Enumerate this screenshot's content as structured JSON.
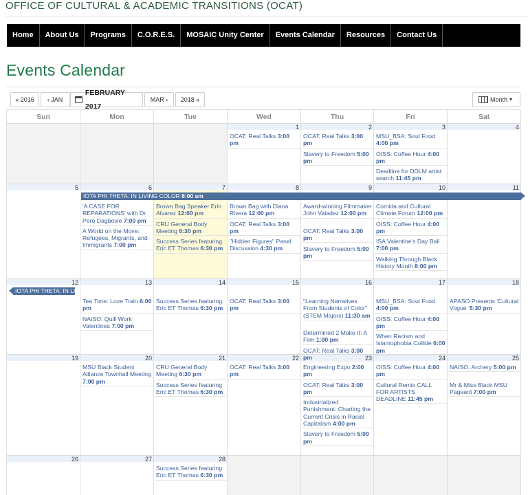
{
  "site": {
    "title": "OFFICE OF CULTURAL & ACADEMIC TRANSITIONS (OCAT)"
  },
  "nav": [
    "Home",
    "About Us",
    "Programs",
    "C.O.R.E.S.",
    "MOSAIC Unity Center",
    "Events Calendar",
    "Resources",
    "Contact Us"
  ],
  "page_title": "Events Calendar",
  "toolbar": {
    "prev_year": "« 2016",
    "prev_month": "‹ JAN",
    "current": "FEBRUARY 2017",
    "next_month": "MAR ›",
    "next_year": "2018 »",
    "view": "Month",
    "calendar_icon": "calendar-icon",
    "view_icon": "grid-icon"
  },
  "weekdays": [
    "Sun",
    "Mon",
    "Tue",
    "Wed",
    "Thu",
    "Fri",
    "Sat"
  ],
  "colors": {
    "brand_green": "#1e7a4a",
    "nav_bg": "#000000",
    "event_link": "#3a5f9a",
    "multi_day_bar": "#4d6f9c",
    "today_bg": "#fffbd8",
    "outside_month_bg": "#f2f2f2"
  },
  "weeks": [
    [
      {
        "day": "",
        "out": true,
        "events": []
      },
      {
        "day": "",
        "out": true,
        "events": []
      },
      {
        "day": "",
        "out": true,
        "events": []
      },
      {
        "day": "1",
        "events": [
          {
            "title": "OCAT: Real Talks",
            "time": "3:00 pm"
          }
        ]
      },
      {
        "day": "2",
        "events": [
          {
            "title": "OCAT: Real Talks",
            "time": "3:00 pm"
          },
          {
            "title": "Slavery to Freedom",
            "time": "5:00 pm"
          }
        ]
      },
      {
        "day": "3",
        "events": [
          {
            "title": "MSU_BSA: Soul Food",
            "time": "4:00 pm"
          },
          {
            "title": "OISS: Coffee Hour",
            "time": "4:00 pm"
          },
          {
            "title": "Deadline for DDLM artist search",
            "time": "11:45 pm"
          }
        ]
      },
      {
        "day": "4",
        "events": []
      }
    ],
    [
      {
        "day": "5",
        "events": []
      },
      {
        "day": "6",
        "events": [
          {
            "title": "'A CASE FOR REPARATIONS' with Dr. Pero Dagbovie",
            "time": "7:00 pm"
          },
          {
            "title": "A World on the Move: Refugees, Migrants, and Immigrants",
            "time": "7:00 pm"
          }
        ]
      },
      {
        "day": "7",
        "today": true,
        "events": [
          {
            "title": "Brown Bag Speaker Erin Alvarez",
            "time": "12:00 pm"
          },
          {
            "title": "CRU General Body Meeting",
            "time": "6:30 pm"
          },
          {
            "title": "Success Series featuring Eric ET Thomas",
            "time": "6:30 pm"
          }
        ]
      },
      {
        "day": "8",
        "events": [
          {
            "title": "Brown Bag with Diana Rivera",
            "time": "12:00 pm"
          },
          {
            "title": "OCAT: Real Talks",
            "time": "3:00 pm"
          },
          {
            "title": "\"Hidden Figures\" Panel Discussion",
            "time": "4:30 pm"
          }
        ]
      },
      {
        "day": "9",
        "events": [
          {
            "title": "Award-winning Filmmaker John Valadez",
            "time": "12:00 pm"
          },
          {
            "title": "OCAT: Real Talks",
            "time": "3:00 pm"
          },
          {
            "title": "Slavery to Freedom",
            "time": "5:00 pm"
          }
        ]
      },
      {
        "day": "10",
        "events": [
          {
            "title": "Comida and Cultural Climate Forum",
            "time": "12:00 pm"
          },
          {
            "title": "OISS: Coffee Hour",
            "time": "4:00 pm"
          },
          {
            "title": "ISA Valentine's Day Ball",
            "time": "7:00 pm"
          },
          {
            "title": "Walking Through Black History Month",
            "time": "8:00 pm"
          }
        ]
      },
      {
        "day": "11",
        "events": []
      }
    ],
    [
      {
        "day": "12",
        "events": []
      },
      {
        "day": "13",
        "events": [
          {
            "title": "Tea Time: Love Train",
            "time": "6:00 pm"
          },
          {
            "title": "NAISO: Quill Work Valentines",
            "time": "7:00 pm"
          }
        ]
      },
      {
        "day": "14",
        "events": [
          {
            "title": "Success Series featuring Eric ET Thomas",
            "time": "6:30 pm"
          }
        ]
      },
      {
        "day": "15",
        "events": [
          {
            "title": "OCAT: Real Talks",
            "time": "3:00 pm"
          }
        ]
      },
      {
        "day": "16",
        "events": [
          {
            "title": "\"Learning Narratives From Students of Color\" (STEM Majors)",
            "time": "11:30 am"
          },
          {
            "title": "Determined 2 Make It: A Film",
            "time": "1:00 pm"
          },
          {
            "title": "OCAT: Real Talks",
            "time": "3:00 pm"
          }
        ]
      },
      {
        "day": "17",
        "events": [
          {
            "title": "MSU_BSA: Soul Food",
            "time": "4:00 pm"
          },
          {
            "title": "OISS: Coffee Hour",
            "time": "4:00 pm"
          },
          {
            "title": "When Racism and Islamophobia Collide",
            "time": "6:00 pm"
          }
        ]
      },
      {
        "day": "18",
        "events": [
          {
            "title": "APASO Presents 'Cultural Vogue'",
            "time": "5:30 pm"
          }
        ]
      }
    ],
    [
      {
        "day": "19",
        "events": []
      },
      {
        "day": "20",
        "events": [
          {
            "title": "MSU Black Student Alliance Townhall Meeting",
            "time": "7:00 pm"
          }
        ]
      },
      {
        "day": "21",
        "events": [
          {
            "title": "CRU General Body Meeting",
            "time": "6:30 pm"
          },
          {
            "title": "Success Series featuring Eric ET Thomas",
            "time": "6:30 pm"
          }
        ]
      },
      {
        "day": "22",
        "events": [
          {
            "title": "OCAT: Real Talks",
            "time": "3:00 pm"
          }
        ]
      },
      {
        "day": "23",
        "events": [
          {
            "title": "Engineering Expo",
            "time": "2:00 pm"
          },
          {
            "title": "OCAT: Real Talks",
            "time": "3:00 pm"
          },
          {
            "title": "Industrialized Punishment: Charting the Current Crisis in Racial Capitalism",
            "time": "4:00 pm"
          },
          {
            "title": "Slavery to Freedom",
            "time": "5:00 pm"
          }
        ]
      },
      {
        "day": "24",
        "events": [
          {
            "title": "OISS: Coffee Hour",
            "time": "4:00 pm"
          },
          {
            "title": "Cultural Remix CALL FOR ARTISTS DEADLINE",
            "time": "11:45 pm"
          }
        ]
      },
      {
        "day": "25",
        "events": [
          {
            "title": "NAISO: Archery",
            "time": "5:00 pm"
          },
          {
            "title": "Mr & Miss Black MSU Pageant",
            "time": "7:00 pm"
          }
        ]
      }
    ],
    [
      {
        "day": "26",
        "events": []
      },
      {
        "day": "27",
        "events": []
      },
      {
        "day": "28",
        "events": [
          {
            "title": "Success Series featuring Eric ET Thomas",
            "time": "6:30 pm"
          }
        ]
      },
      {
        "day": "",
        "out": true,
        "events": []
      },
      {
        "day": "",
        "out": true,
        "events": []
      },
      {
        "day": "",
        "out": true,
        "events": []
      },
      {
        "day": "",
        "out": true,
        "events": []
      }
    ]
  ],
  "multi_day": [
    {
      "week": 1,
      "start_col": 1,
      "title": "IOTA PHI THETA: IN LIVING COLOR",
      "time": "8:00 am",
      "continues_right": true,
      "continues_left": false
    },
    {
      "week": 2,
      "start_col": 0,
      "title": "IOTA PHI THETA: IN LIVING COLOR",
      "time": "",
      "continues_right": false,
      "continues_left": true
    }
  ]
}
